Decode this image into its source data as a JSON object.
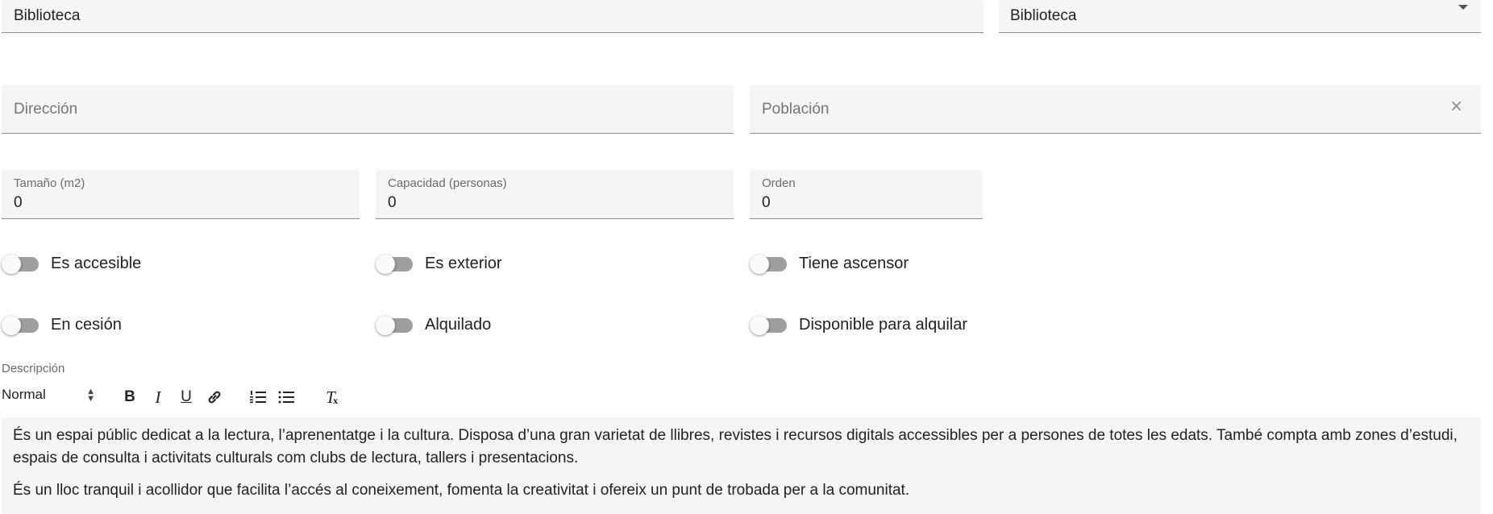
{
  "top_row": {
    "name_field": {
      "value": "Biblioteca"
    },
    "type_select": {
      "value": "Biblioteca"
    }
  },
  "address_row": {
    "address_field": {
      "placeholder": "Dirección"
    },
    "town_field": {
      "placeholder": "Población",
      "clear_icon": "×"
    }
  },
  "numbers_row": {
    "size": {
      "label": "Tamaño (m2)",
      "value": "0"
    },
    "capacity": {
      "label": "Capacidad (personas)",
      "value": "0"
    },
    "order": {
      "label": "Orden",
      "value": "0"
    }
  },
  "toggles": [
    {
      "label": "Es accesible",
      "checked": false
    },
    {
      "label": "Es exterior",
      "checked": false
    },
    {
      "label": "Tiene ascensor",
      "checked": false
    },
    {
      "label": "En cesión",
      "checked": false
    },
    {
      "label": "Alquilado",
      "checked": false
    },
    {
      "label": "Disponible para alquilar",
      "checked": false
    }
  ],
  "description": {
    "label": "Descripción",
    "toolbar": {
      "format_select": "Normal",
      "bold": "B",
      "italic": "I",
      "underline": "U",
      "clear_format": "T"
    },
    "paragraphs": [
      "És un espai públic dedicat a la lectura, l’aprenentatge i la cultura. Disposa d’una gran varietat de llibres, revistes i recursos digitals accessibles per a persones de totes les edats. També compta amb zones d’estudi, espais de consulta i activitats culturals com clubs de lectura, tallers i presentacions.",
      "És un lloc tranquil i acollidor que facilita l’accés al coneixement, fomenta la creativitat i ofereix un punt de trobada per a la comunitat."
    ]
  },
  "colors": {
    "field_background": "#f5f5f5",
    "toggle_track": "#9e9e9e",
    "toggle_thumb": "#fafafa"
  }
}
